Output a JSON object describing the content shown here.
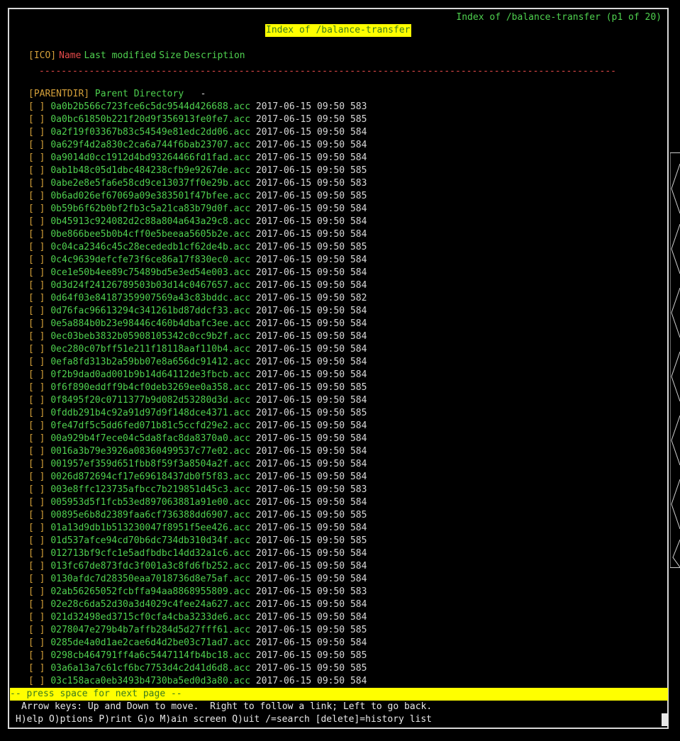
{
  "app": {
    "window_title": "Index of /balance-transfer (p1 of 20)",
    "page_heading": "Index of /balance-transfer"
  },
  "colors": {
    "background": "#000000",
    "link": "#4fd14f",
    "accent_red": "#e44a4a",
    "bracket": "#d4a03a",
    "highlight": "#ffff00"
  },
  "header": {
    "ico": "[ICO]",
    "name": "Name",
    "last_modified": "Last modified",
    "size": "Size",
    "description": "Description"
  },
  "rule": "---------------------------------------------------------------------------------------------------------------",
  "parent": {
    "tag": "[PARENTDIR]",
    "label": "Parent Directory",
    "size": "-"
  },
  "files": [
    {
      "icon": "[ ]",
      "name": "0a0b2b566c723fce6c5dc9544d426688.acc",
      "modified": "2017-06-15 09:50",
      "size": "583"
    },
    {
      "icon": "[ ]",
      "name": "0a0bc61850b221f20d9f356913fe0fe7.acc",
      "modified": "2017-06-15 09:50",
      "size": "585"
    },
    {
      "icon": "[ ]",
      "name": "0a2f19f03367b83c54549e81edc2dd06.acc",
      "modified": "2017-06-15 09:50",
      "size": "584"
    },
    {
      "icon": "[ ]",
      "name": "0a629f4d2a830c2ca6a744f6bab23707.acc",
      "modified": "2017-06-15 09:50",
      "size": "584"
    },
    {
      "icon": "[ ]",
      "name": "0a9014d0cc1912d4bd93264466fd1fad.acc",
      "modified": "2017-06-15 09:50",
      "size": "584"
    },
    {
      "icon": "[ ]",
      "name": "0ab1b48c05d1dbc484238cfb9e9267de.acc",
      "modified": "2017-06-15 09:50",
      "size": "585"
    },
    {
      "icon": "[ ]",
      "name": "0abe2e8e5fa6e58cd9ce13037ff0e29b.acc",
      "modified": "2017-06-15 09:50",
      "size": "583"
    },
    {
      "icon": "[ ]",
      "name": "0b6ad026ef67069a09e383501f47bfee.acc",
      "modified": "2017-06-15 09:50",
      "size": "585"
    },
    {
      "icon": "[ ]",
      "name": "0b59b6f62b0bf2fb3c5a21ca83b79d0f.acc",
      "modified": "2017-06-15 09:50",
      "size": "584"
    },
    {
      "icon": "[ ]",
      "name": "0b45913c924082d2c88a804a643a29c8.acc",
      "modified": "2017-06-15 09:50",
      "size": "584"
    },
    {
      "icon": "[ ]",
      "name": "0be866bee5b0b4cff0e5beeaa5605b2e.acc",
      "modified": "2017-06-15 09:50",
      "size": "584"
    },
    {
      "icon": "[ ]",
      "name": "0c04ca2346c45c28ecededb1cf62de4b.acc",
      "modified": "2017-06-15 09:50",
      "size": "585"
    },
    {
      "icon": "[ ]",
      "name": "0c4c9639defcfe73f6ce86a17f830ec0.acc",
      "modified": "2017-06-15 09:50",
      "size": "584"
    },
    {
      "icon": "[ ]",
      "name": "0ce1e50b4ee89c75489bd5e3ed54e003.acc",
      "modified": "2017-06-15 09:50",
      "size": "584"
    },
    {
      "icon": "[ ]",
      "name": "0d3d24f24126789503b03d14c0467657.acc",
      "modified": "2017-06-15 09:50",
      "size": "584"
    },
    {
      "icon": "[ ]",
      "name": "0d64f03e84187359907569a43c83bddc.acc",
      "modified": "2017-06-15 09:50",
      "size": "582"
    },
    {
      "icon": "[ ]",
      "name": "0d76fac96613294c341261bd87ddcf33.acc",
      "modified": "2017-06-15 09:50",
      "size": "584"
    },
    {
      "icon": "[ ]",
      "name": "0e5a884b0b23e98446c460b4dbafc3ee.acc",
      "modified": "2017-06-15 09:50",
      "size": "584"
    },
    {
      "icon": "[ ]",
      "name": "0ec03beb3832b05908105342c0cc9b2f.acc",
      "modified": "2017-06-15 09:50",
      "size": "584"
    },
    {
      "icon": "[ ]",
      "name": "0ec280c07bff51e211f18118aaf110b4.acc",
      "modified": "2017-06-15 09:50",
      "size": "584"
    },
    {
      "icon": "[ ]",
      "name": "0efa8fd313b2a59bb07e8a656dc91412.acc",
      "modified": "2017-06-15 09:50",
      "size": "584"
    },
    {
      "icon": "[ ]",
      "name": "0f2b9dad0ad001b9b14d64112de3fbcb.acc",
      "modified": "2017-06-15 09:50",
      "size": "584"
    },
    {
      "icon": "[ ]",
      "name": "0f6f890eddff9b4cf0deb3269ee0a358.acc",
      "modified": "2017-06-15 09:50",
      "size": "585"
    },
    {
      "icon": "[ ]",
      "name": "0f8495f20c0711377b9d082d53280d3d.acc",
      "modified": "2017-06-15 09:50",
      "size": "584"
    },
    {
      "icon": "[ ]",
      "name": "0fddb291b4c92a91d97d9f148dce4371.acc",
      "modified": "2017-06-15 09:50",
      "size": "585"
    },
    {
      "icon": "[ ]",
      "name": "0fe47df5c5dd6fed071b81c5ccfd29e2.acc",
      "modified": "2017-06-15 09:50",
      "size": "584"
    },
    {
      "icon": "[ ]",
      "name": "00a929b4f7ece04c5da8fac8da8370a0.acc",
      "modified": "2017-06-15 09:50",
      "size": "584"
    },
    {
      "icon": "[ ]",
      "name": "0016a3b79e3926a08360499537c77e02.acc",
      "modified": "2017-06-15 09:50",
      "size": "584"
    },
    {
      "icon": "[ ]",
      "name": "001957ef359d651fbb8f59f3a8504a2f.acc",
      "modified": "2017-06-15 09:50",
      "size": "584"
    },
    {
      "icon": "[ ]",
      "name": "0026d872694cf17e69618437db0f5f83.acc",
      "modified": "2017-06-15 09:50",
      "size": "584"
    },
    {
      "icon": "[ ]",
      "name": "003e8ffc123735afbcc7b219851d45c3.acc",
      "modified": "2017-06-15 09:50",
      "size": "583"
    },
    {
      "icon": "[ ]",
      "name": "005953d5f1fcb53ed897063881a91e00.acc",
      "modified": "2017-06-15 09:50",
      "size": "584"
    },
    {
      "icon": "[ ]",
      "name": "00895e6b8d2389faa6cf736388dd6907.acc",
      "modified": "2017-06-15 09:50",
      "size": "585"
    },
    {
      "icon": "[ ]",
      "name": "01a13d9db1b513230047f8951f5ee426.acc",
      "modified": "2017-06-15 09:50",
      "size": "584"
    },
    {
      "icon": "[ ]",
      "name": "01d537afce94cd70b6dc734db310d34f.acc",
      "modified": "2017-06-15 09:50",
      "size": "585"
    },
    {
      "icon": "[ ]",
      "name": "012713bf9cfc1e5adfbdbc14dd32a1c6.acc",
      "modified": "2017-06-15 09:50",
      "size": "584"
    },
    {
      "icon": "[ ]",
      "name": "013fc67de873fdc3f001a3c8fd6fb252.acc",
      "modified": "2017-06-15 09:50",
      "size": "584"
    },
    {
      "icon": "[ ]",
      "name": "0130afdc7d28350eaa7018736d8e75af.acc",
      "modified": "2017-06-15 09:50",
      "size": "584"
    },
    {
      "icon": "[ ]",
      "name": "02ab56265052fcbffa94aa8868955809.acc",
      "modified": "2017-06-15 09:50",
      "size": "583"
    },
    {
      "icon": "[ ]",
      "name": "02e28c6da52d30a3d4029c4fee24a627.acc",
      "modified": "2017-06-15 09:50",
      "size": "584"
    },
    {
      "icon": "[ ]",
      "name": "021d32498ed3715cf0cfa4cba3233de6.acc",
      "modified": "2017-06-15 09:50",
      "size": "584"
    },
    {
      "icon": "[ ]",
      "name": "0278047e279b4b7affb284d5d27fff61.acc",
      "modified": "2017-06-15 09:50",
      "size": "585"
    },
    {
      "icon": "[ ]",
      "name": "0285de4a0d1ae2cae6d4d2be03c71ad7.acc",
      "modified": "2017-06-15 09:50",
      "size": "584"
    },
    {
      "icon": "[ ]",
      "name": "0298cb464791ff4a6c5447114fb4bc18.acc",
      "modified": "2017-06-15 09:50",
      "size": "585"
    },
    {
      "icon": "[ ]",
      "name": "03a6a13a7c61cf6bc7753d4c2d41d6d8.acc",
      "modified": "2017-06-15 09:50",
      "size": "585"
    },
    {
      "icon": "[ ]",
      "name": "03c158aca0eb3493b4730ba5ed0d3a80.acc",
      "modified": "2017-06-15 09:50",
      "size": "584"
    }
  ],
  "status": {
    "next_page": "-- press space for next page --",
    "help_line_1": "Arrow keys: Up and Down to move.  Right to follow a link; Left to go back.",
    "help_line_2": "H)elp O)ptions P)rint G)o M)ain screen Q)uit /=search [delete]=history list"
  }
}
